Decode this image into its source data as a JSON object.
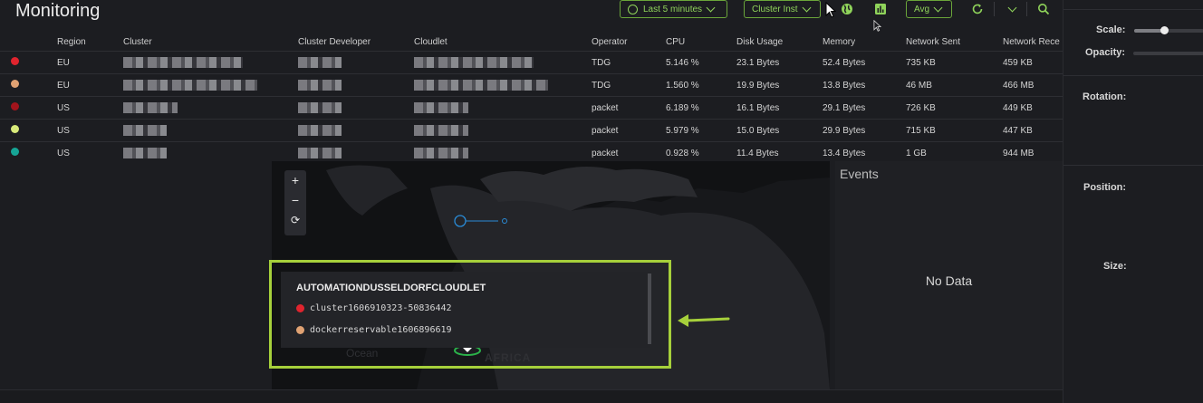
{
  "header": {
    "title": "Monitoring",
    "time_range": "Last 5 minutes",
    "view_select": "Cluster Inst",
    "aggregation": "Avg"
  },
  "table": {
    "columns": [
      "Region",
      "Cluster",
      "Cluster Developer",
      "Cloudlet",
      "Operator",
      "CPU",
      "Disk Usage",
      "Memory",
      "Network Sent",
      "Network Rece"
    ],
    "rows": [
      {
        "color": "#e0242e",
        "region": "EU",
        "operator": "TDG",
        "cpu": "5.146 %",
        "disk": "23.1 Bytes",
        "memory": "52.4 Bytes",
        "net_sent": "735 KB",
        "net_recv": "459 KB"
      },
      {
        "color": "#e0a273",
        "region": "EU",
        "operator": "TDG",
        "cpu": "1.560 %",
        "disk": "19.9 Bytes",
        "memory": "13.8 Bytes",
        "net_sent": "46 MB",
        "net_recv": "466 MB"
      },
      {
        "color": "#a3141c",
        "region": "US",
        "operator": "packet",
        "cpu": "6.189 %",
        "disk": "16.1 Bytes",
        "memory": "29.1 Bytes",
        "net_sent": "726 KB",
        "net_recv": "449 KB"
      },
      {
        "color": "#d8ea7a",
        "region": "US",
        "operator": "packet",
        "cpu": "5.979 %",
        "disk": "15.0 Bytes",
        "memory": "29.9 Bytes",
        "net_sent": "715 KB",
        "net_recv": "447 KB"
      },
      {
        "color": "#16a596",
        "region": "US",
        "operator": "packet",
        "cpu": "0.928 %",
        "disk": "11.4 Bytes",
        "memory": "13.4 Bytes",
        "net_sent": "1 GB",
        "net_recv": "944 MB"
      }
    ]
  },
  "map": {
    "zoom_in": "+",
    "zoom_out": "−",
    "reset": "⟳",
    "ocean_label": "Ocean",
    "africa_label": "AFRICA"
  },
  "popup": {
    "title": "AUTOMATIONDUSSELDORFCLOUDLET",
    "items": [
      {
        "label": "cluster1606910323-50836442",
        "color": "#e0242e"
      },
      {
        "label": "dockerreservable1606896619",
        "color": "#e0a273"
      }
    ]
  },
  "events": {
    "title": "Events",
    "empty_text": "No Data"
  },
  "properties": {
    "scale_label": "Scale:",
    "opacity_label": "Opacity:",
    "rotation_label": "Rotation:",
    "position_label": "Position:",
    "size_label": "Size:"
  },
  "accent_color": "#a6d03b"
}
